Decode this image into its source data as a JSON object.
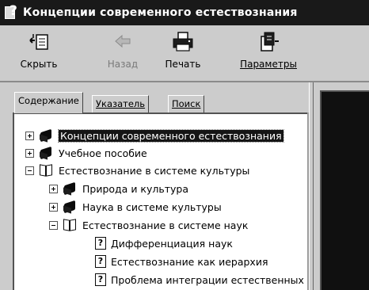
{
  "window": {
    "title": "Концепции современного естествознания",
    "title_icon": "help-book-icon"
  },
  "toolbar": {
    "buttons": [
      {
        "label": "Скрыть",
        "icon": "hide-pane-icon",
        "enabled": true
      },
      {
        "label": "Назад",
        "icon": "back-arrow-icon",
        "enabled": false
      },
      {
        "label": "Печать",
        "icon": "printer-icon",
        "enabled": true
      },
      {
        "label": "Параметры",
        "icon": "options-icon",
        "enabled": true
      }
    ]
  },
  "tabs": {
    "contents": "Содержание",
    "index": "Указатель",
    "search": "Поиск",
    "active": "contents"
  },
  "tree": {
    "items": [
      {
        "label": "Концепции современного естествознания",
        "icon": "closed-book-icon",
        "expander": "collapsed",
        "selected": true
      },
      {
        "label": "Учебное пособие",
        "icon": "closed-book-icon",
        "expander": "collapsed",
        "selected": false
      },
      {
        "label": "Естествознание в системе культуры",
        "icon": "open-book-icon",
        "expander": "expanded",
        "selected": false
      },
      {
        "label": "Природа и культура",
        "icon": "closed-book-icon",
        "expander": "collapsed",
        "selected": false
      },
      {
        "label": "Наука в системе культуры",
        "icon": "closed-book-icon",
        "expander": "collapsed",
        "selected": false
      },
      {
        "label": "Естествознание в системе наук",
        "icon": "open-book-icon",
        "expander": "expanded",
        "selected": false
      },
      {
        "label": "Дифференциация наук",
        "icon": "topic-page-icon",
        "expander": "none",
        "selected": false
      },
      {
        "label": "Естествознание как иерархия",
        "icon": "topic-page-icon",
        "expander": "none",
        "selected": false
      },
      {
        "label": "Проблема интеграции естественных",
        "icon": "topic-page-icon",
        "expander": "none",
        "selected": false
      }
    ]
  },
  "colors": {
    "titlebar": "#1e1e1e",
    "chrome": "#c8c8c8",
    "content_dark": "#151515",
    "tree_bg": "#ffffff"
  }
}
